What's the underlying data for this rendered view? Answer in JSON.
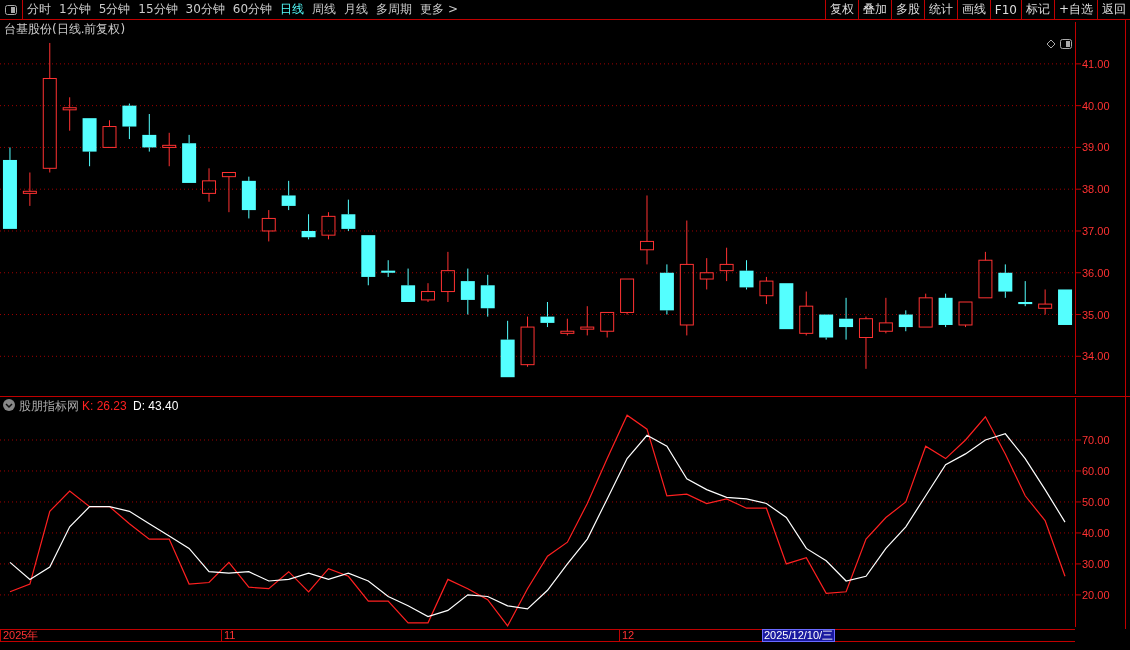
{
  "toolbar": {
    "periods": [
      {
        "label": "分时",
        "selected": false
      },
      {
        "label": "1分钟",
        "selected": false
      },
      {
        "label": "5分钟",
        "selected": false
      },
      {
        "label": "15分钟",
        "selected": false
      },
      {
        "label": "30分钟",
        "selected": false
      },
      {
        "label": "60分钟",
        "selected": false
      },
      {
        "label": "日线",
        "selected": true
      },
      {
        "label": "周线",
        "selected": false
      },
      {
        "label": "月线",
        "selected": false
      },
      {
        "label": "多周期",
        "selected": false
      },
      {
        "label": "更多 >",
        "selected": false
      }
    ],
    "buttons": [
      "复权",
      "叠加",
      "多股",
      "统计",
      "画线",
      "F10",
      "标记",
      "+自选",
      "返回"
    ]
  },
  "price_panel": {
    "chart_data": {
      "type": "candlestick",
      "title": "台基股份(日线.前复权)",
      "grid": true,
      "yticks": [
        {
          "value": 34,
          "label": "34.00"
        },
        {
          "value": 35,
          "label": "35.00"
        },
        {
          "value": 36,
          "label": "36.00"
        },
        {
          "value": 37,
          "label": "37.00"
        },
        {
          "value": 38,
          "label": "38.00"
        },
        {
          "value": 39,
          "label": "39.00"
        },
        {
          "value": 40,
          "label": "40.00"
        },
        {
          "value": 41,
          "label": "41.00"
        }
      ],
      "ylim": [
        33.05,
        42.05
      ],
      "ohlc": [
        [
          38.7,
          39.0,
          37.05,
          37.05
        ],
        [
          37.9,
          38.4,
          37.6,
          37.95
        ],
        [
          38.5,
          41.5,
          38.4,
          40.65
        ],
        [
          39.9,
          40.2,
          39.4,
          39.95
        ],
        [
          39.7,
          39.7,
          38.55,
          38.9
        ],
        [
          39.0,
          39.65,
          39.0,
          39.5
        ],
        [
          40.0,
          40.05,
          39.2,
          39.5
        ],
        [
          39.3,
          39.8,
          38.9,
          39.0
        ],
        [
          39.0,
          39.35,
          38.55,
          39.05
        ],
        [
          39.1,
          39.3,
          38.15,
          38.15
        ],
        [
          37.9,
          38.5,
          37.7,
          38.2
        ],
        [
          38.3,
          38.4,
          37.45,
          38.4
        ],
        [
          38.2,
          38.3,
          37.3,
          37.5
        ],
        [
          37.0,
          37.5,
          36.75,
          37.3
        ],
        [
          37.85,
          38.2,
          37.5,
          37.6
        ],
        [
          37.0,
          37.4,
          36.8,
          36.85
        ],
        [
          36.9,
          37.45,
          36.8,
          37.35
        ],
        [
          37.4,
          37.75,
          37.0,
          37.05
        ],
        [
          36.9,
          36.9,
          35.7,
          35.9
        ],
        [
          36.05,
          36.3,
          35.9,
          36.0
        ],
        [
          35.7,
          36.1,
          35.3,
          35.3
        ],
        [
          35.35,
          35.75,
          35.3,
          35.55
        ],
        [
          35.55,
          36.5,
          35.3,
          36.05
        ],
        [
          35.8,
          36.1,
          35.0,
          35.35
        ],
        [
          35.7,
          35.95,
          34.95,
          35.15
        ],
        [
          34.4,
          34.85,
          33.5,
          33.5
        ],
        [
          33.8,
          34.95,
          33.75,
          34.7
        ],
        [
          34.95,
          35.3,
          34.7,
          34.8
        ],
        [
          34.55,
          34.9,
          34.5,
          34.6
        ],
        [
          34.65,
          35.2,
          34.5,
          34.7
        ],
        [
          34.6,
          35.05,
          34.45,
          35.05
        ],
        [
          35.05,
          35.85,
          35.0,
          35.85
        ],
        [
          36.55,
          37.85,
          36.2,
          36.75
        ],
        [
          36.0,
          36.2,
          35.0,
          35.1
        ],
        [
          34.75,
          37.25,
          34.5,
          36.2
        ],
        [
          35.85,
          36.35,
          35.6,
          36.0
        ],
        [
          36.05,
          36.6,
          35.8,
          36.2
        ],
        [
          36.05,
          36.3,
          35.6,
          35.65
        ],
        [
          35.45,
          35.9,
          35.25,
          35.8
        ],
        [
          35.75,
          35.75,
          34.65,
          34.65
        ],
        [
          34.55,
          35.55,
          34.5,
          35.2
        ],
        [
          35.0,
          35.0,
          34.4,
          34.45
        ],
        [
          34.9,
          35.4,
          34.4,
          34.7
        ],
        [
          34.45,
          34.95,
          33.7,
          34.9
        ],
        [
          34.6,
          35.4,
          34.55,
          34.8
        ],
        [
          35.0,
          35.1,
          34.6,
          34.7
        ],
        [
          34.7,
          35.5,
          34.7,
          35.4
        ],
        [
          35.4,
          35.5,
          34.7,
          34.75
        ],
        [
          34.75,
          35.3,
          34.7,
          35.3
        ],
        [
          35.4,
          36.5,
          35.4,
          36.3
        ],
        [
          36.0,
          36.2,
          35.4,
          35.55
        ],
        [
          35.3,
          35.8,
          35.2,
          35.25
        ],
        [
          35.15,
          35.6,
          35.0,
          35.25
        ],
        [
          35.6,
          35.6,
          34.75,
          34.75
        ]
      ]
    }
  },
  "date_axis": {
    "labels": [
      {
        "text": "2025年",
        "selected": false
      },
      {
        "text": "11",
        "selected": false
      },
      {
        "text": "12",
        "selected": false
      },
      {
        "text": "2025/12/10/三",
        "selected": true
      }
    ]
  },
  "indicator_panel": {
    "name": "股朋指标网",
    "readings": [
      "26.23",
      "43.40"
    ],
    "chart_data": {
      "type": "line",
      "grid": true,
      "yticks": [
        {
          "value": 20,
          "label": "20.00"
        },
        {
          "value": 30,
          "label": "30.00"
        },
        {
          "value": 40,
          "label": "40.00"
        },
        {
          "value": 50,
          "label": "50.00"
        },
        {
          "value": 60,
          "label": "60.00"
        },
        {
          "value": 70,
          "label": "70.00"
        }
      ],
      "ylim": [
        9,
        84.2
      ],
      "series": [
        {
          "name": "K:",
          "color": "#ff2020",
          "values": [
            21,
            23.5,
            47,
            53.5,
            48.5,
            48.5,
            43,
            38,
            38,
            23.5,
            24,
            30.5,
            22.5,
            22,
            27.5,
            21,
            28.5,
            26,
            18,
            18,
            11,
            11,
            25,
            22,
            18.5,
            10,
            22,
            32.5,
            37,
            49.5,
            64,
            78,
            73.5,
            52,
            52.5,
            49.5,
            51,
            48,
            48,
            30,
            32,
            20.5,
            21,
            38,
            45,
            50,
            68,
            64,
            70,
            77.5,
            65.5,
            52,
            44,
            26
          ]
        },
        {
          "name": "D:",
          "color": "#ffffff",
          "values": [
            30.5,
            25,
            29,
            42,
            48.5,
            48.5,
            47,
            43,
            39,
            35,
            27.5,
            27,
            27.5,
            24.5,
            25,
            27,
            25,
            27,
            24.5,
            19.5,
            16.5,
            13,
            15,
            20,
            19.5,
            16.5,
            15.5,
            21.5,
            30,
            38,
            51,
            64,
            71.5,
            68,
            57.5,
            54,
            51.5,
            51,
            49.5,
            45,
            35,
            31,
            24.5,
            26,
            35,
            42,
            52,
            62,
            65.5,
            70,
            72,
            64,
            54,
            43.5
          ]
        }
      ]
    }
  }
}
